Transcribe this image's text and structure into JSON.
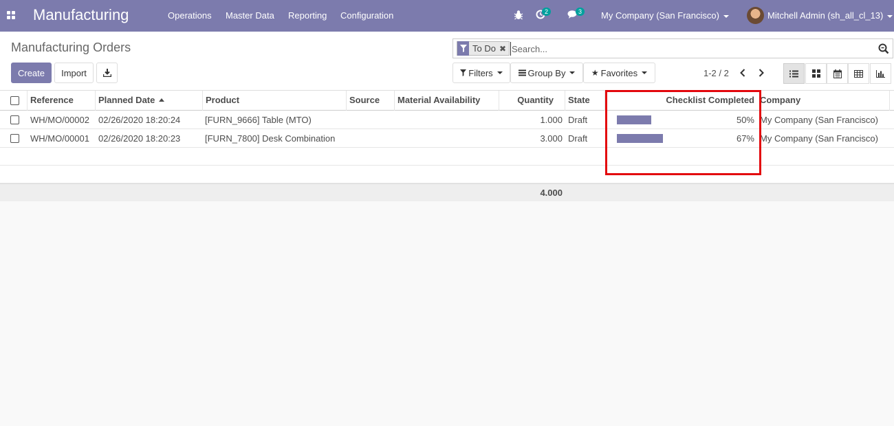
{
  "navbar": {
    "brand": "Manufacturing",
    "menu": [
      "Operations",
      "Master Data",
      "Reporting",
      "Configuration"
    ],
    "activity_count": "2",
    "messages_count": "3",
    "company": "My Company (San Francisco)",
    "user": "Mitchell Admin (sh_all_cl_13)",
    "bg_color": "#7c7bad"
  },
  "control_panel": {
    "breadcrumb": "Manufacturing Orders",
    "create_label": "Create",
    "import_label": "Import",
    "search": {
      "facet_label": "To Do",
      "placeholder": "Search..."
    },
    "filters_label": "Filters",
    "groupby_label": "Group By",
    "favorites_label": "Favorites",
    "pager": "1-2 / 2"
  },
  "table": {
    "columns": {
      "reference": "Reference",
      "planned_date": "Planned Date",
      "product": "Product",
      "source": "Source",
      "material_availability": "Material Availability",
      "quantity": "Quantity",
      "state": "State",
      "checklist": "Checklist Completed",
      "company": "Company"
    },
    "rows": [
      {
        "reference": "WH/MO/00002",
        "planned_date": "02/26/2020 18:20:24",
        "product": "[FURN_9666] Table (MTO)",
        "source": "",
        "material_availability": "",
        "quantity": "1.000",
        "state": "Draft",
        "checklist_value": 50,
        "checklist_label": "50%",
        "company": "My Company (San Francisco)"
      },
      {
        "reference": "WH/MO/00001",
        "planned_date": "02/26/2020 18:20:23",
        "product": "[FURN_7800] Desk Combination",
        "source": "",
        "material_availability": "",
        "quantity": "3.000",
        "state": "Draft",
        "checklist_value": 67,
        "checklist_label": "67%",
        "company": "My Company (San Francisco)"
      }
    ],
    "total_quantity": "4.000"
  }
}
